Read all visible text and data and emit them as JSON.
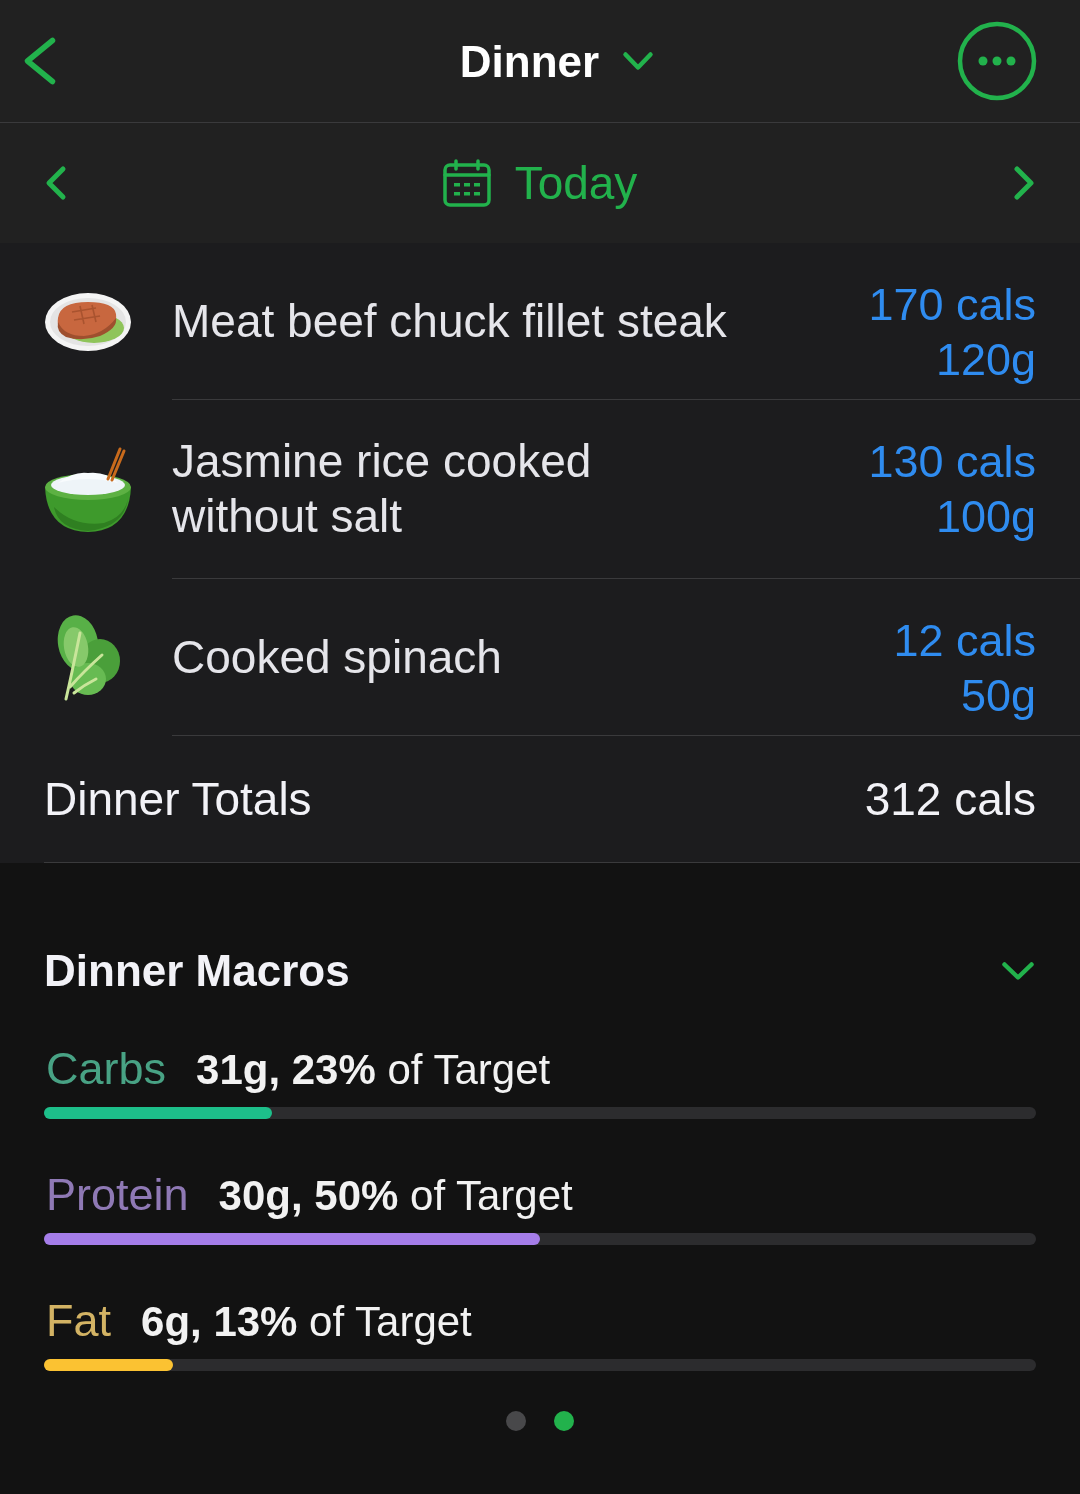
{
  "navigation": {
    "title": "Dinner"
  },
  "date_bar": {
    "label": "Today"
  },
  "foods": [
    {
      "name": "Meat beef chuck fillet steak",
      "calories": "170 cals",
      "amount": "120g"
    },
    {
      "name": "Jasmine rice cooked without salt",
      "calories": "130 cals",
      "amount": "100g"
    },
    {
      "name": "Cooked spinach",
      "calories": "12 cals",
      "amount": "50g"
    }
  ],
  "totals": {
    "label": "Dinner Totals",
    "calories": "312 cals"
  },
  "macros": {
    "title": "Dinner Macros",
    "items": [
      {
        "name": "Carbs",
        "detail": "**31g, 23%** of Target",
        "level": 0.23,
        "color": "#1dbf8a"
      },
      {
        "name": "Protein",
        "detail": "**30g, 50%** of Target",
        "level": 0.5,
        "color": "#a57de9"
      },
      {
        "name": "Fat",
        "detail": "**6g, 13%** of Target",
        "level": 0.13,
        "color": "#fbc232"
      }
    ]
  },
  "pager": [
    {
      "selected": false
    },
    {
      "selected": true
    }
  ]
}
